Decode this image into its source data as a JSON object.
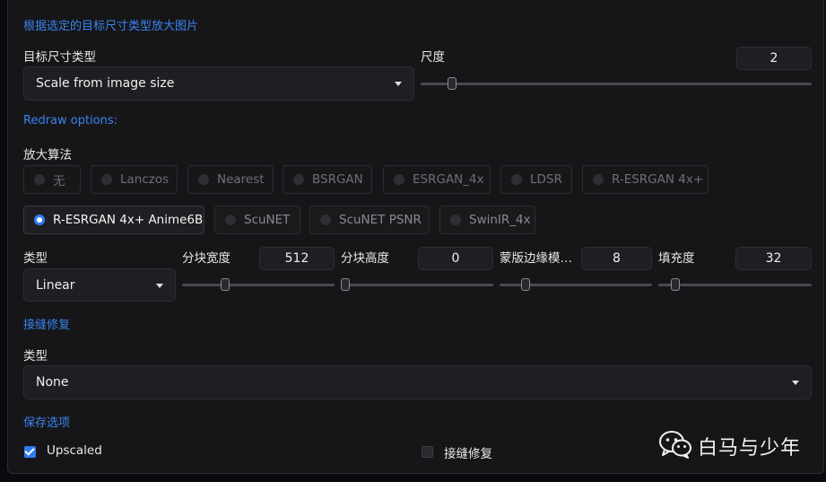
{
  "section_title": "根据选定的目标尺寸类型放大图片",
  "target_size": {
    "label": "目标尺寸类型",
    "value": "Scale from image size"
  },
  "scale": {
    "label": "尺度",
    "value": "2",
    "slider_fraction": 0.07
  },
  "redraw_title": "Redraw options:",
  "upscaler": {
    "label": "放大算法",
    "options": [
      {
        "label": "无",
        "state": "disabled"
      },
      {
        "label": "Lanczos",
        "state": "disabled"
      },
      {
        "label": "Nearest",
        "state": "disabled"
      },
      {
        "label": "BSRGAN",
        "state": "disabled"
      },
      {
        "label": "ESRGAN_4x",
        "state": "disabled"
      },
      {
        "label": "LDSR",
        "state": "disabled"
      },
      {
        "label": "R-ESRGAN 4x+",
        "state": "disabled"
      },
      {
        "label": "R-ESRGAN 4x+ Anime6B",
        "state": "selected"
      },
      {
        "label": "ScuNET",
        "state": "normal"
      },
      {
        "label": "ScuNET PSNR",
        "state": "normal"
      },
      {
        "label": "SwinIR_4x",
        "state": "normal"
      }
    ]
  },
  "type": {
    "label": "类型",
    "value": "Linear"
  },
  "tile_width": {
    "label": "分块宽度",
    "value": "512",
    "slider_fraction": 0.27
  },
  "tile_height": {
    "label": "分块高度",
    "value": "0",
    "slider_fraction": 0.0
  },
  "mask_blur": {
    "label": "蒙版边缘模…",
    "value": "8",
    "slider_fraction": 0.15
  },
  "padding": {
    "label": "填充度",
    "value": "32",
    "slider_fraction": 0.09
  },
  "seams_title": "接缝修复",
  "seams_type": {
    "label": "类型",
    "value": "None"
  },
  "save_title": "保存选项",
  "save": {
    "upscaled_label": "Upscaled",
    "upscaled_checked": true,
    "seams_label": "接缝修复",
    "seams_checked": false
  },
  "watermark": {
    "text": "白马与少年",
    "icon": "wechat-icon"
  },
  "colors": {
    "accent": "#2f7df5",
    "section_title": "#3a84f0",
    "panel_bg": "#161619"
  }
}
